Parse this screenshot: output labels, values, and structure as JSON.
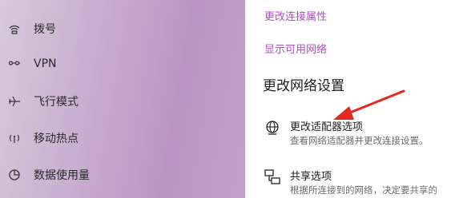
{
  "sidebar": {
    "items": [
      {
        "label": "拨号",
        "icon": "dialup-icon"
      },
      {
        "label": "VPN",
        "icon": "vpn-icon"
      },
      {
        "label": "飞行模式",
        "icon": "airplane-icon"
      },
      {
        "label": "移动热点",
        "icon": "hotspot-icon"
      },
      {
        "label": "数据使用量",
        "icon": "data-usage-icon"
      }
    ]
  },
  "main": {
    "links": [
      "更改连接属性",
      "显示可用网络"
    ],
    "section_title": "更改网络设置",
    "options": [
      {
        "title": "更改适配器选项",
        "description": "查看网络适配器并更改连接设置。",
        "icon": "adapter-icon"
      },
      {
        "title": "共享选项",
        "description": "根据所连接到的网络，决定要共享的",
        "icon": "sharing-icon"
      }
    ]
  },
  "colors": {
    "link": "#b24bc6",
    "annotation_arrow": "#e8281e",
    "sidebar_tint": "#c9afd0"
  }
}
